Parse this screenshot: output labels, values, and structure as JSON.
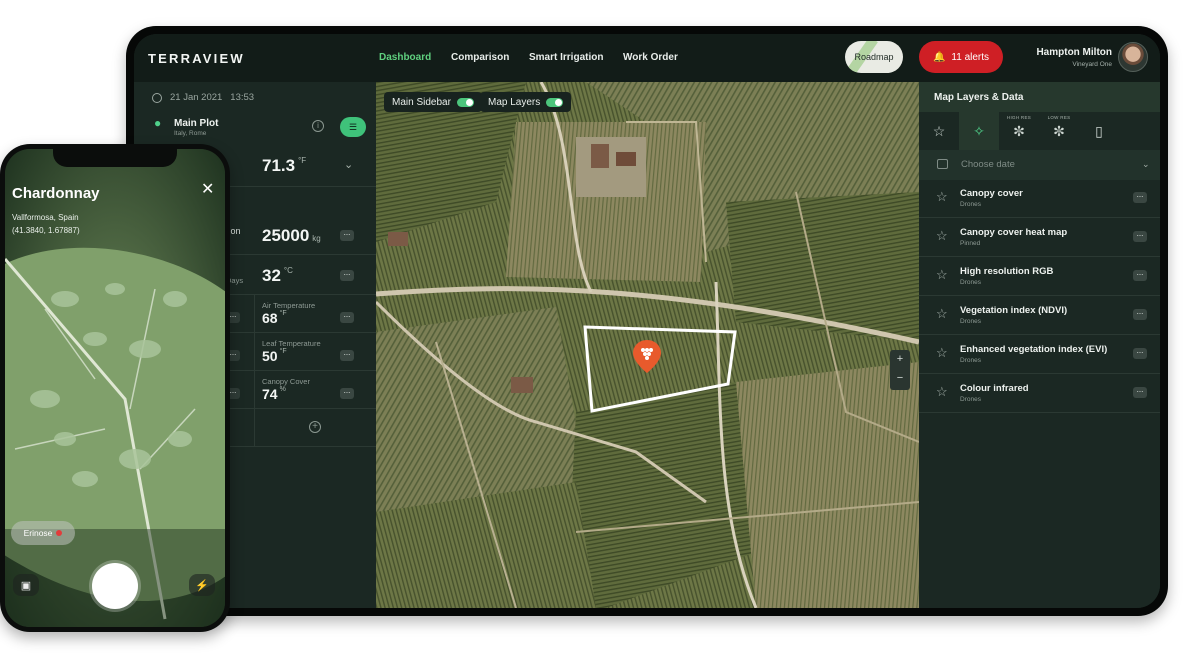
{
  "tablet": {
    "brand": "TERRAVIEW",
    "nav": [
      "Dashboard",
      "Comparison",
      "Smart Irrigation",
      "Work Order"
    ],
    "roadmap_label": "Roadmap",
    "alerts_label": "11 alerts",
    "user": {
      "name": "Hampton Milton",
      "subtitle": "Vineyard One"
    },
    "sidebar": {
      "date": "21 Jan 2021",
      "time": "13:53",
      "plot_title": "Main Plot",
      "plot_subtitle": "Italy, Rome",
      "metric1": {
        "value": "71.3",
        "unit": "°F"
      },
      "metric2": {
        "partial_label": "tion",
        "value": "25000",
        "unit": "kg"
      },
      "metric3": {
        "partial_label": "Days",
        "value": "32",
        "unit": "°C"
      },
      "cards": [
        {
          "label": "Air Temperature",
          "value": "68",
          "unit": "°F"
        },
        {
          "label": "Leaf Temperature",
          "value": "50",
          "unit": "°F"
        },
        {
          "label": "Canopy Cover",
          "value": "74",
          "unit": "%"
        }
      ]
    },
    "map": {
      "toggle_sidebar": "Main Sidebar",
      "toggle_layers": "Map Layers"
    },
    "panel": {
      "title": "Map Layers & Data",
      "tab_labels": [
        "HIGH RES",
        "LOW RES"
      ],
      "choose_date": "Choose date",
      "layers": [
        {
          "title": "Canopy cover",
          "source": "Drones"
        },
        {
          "title": "Canopy cover heat map",
          "source": "Pinned"
        },
        {
          "title": "High resolution RGB",
          "source": "Drones"
        },
        {
          "title": "Vegetation index (NDVI)",
          "source": "Drones"
        },
        {
          "title": "Enhanced vegetation index (EVI)",
          "source": "Drones"
        },
        {
          "title": "Colour infrared",
          "source": "Drones"
        }
      ]
    }
  },
  "phone": {
    "title": "Chardonnay",
    "location": "Vallformosa, Spain",
    "coords": "(41.3840, 1.67887)",
    "tag": "Erinose"
  },
  "colors": {
    "accent_green": "#5fd07f",
    "alert_red": "#cf1f25",
    "panel_dark": "#1b2823"
  }
}
